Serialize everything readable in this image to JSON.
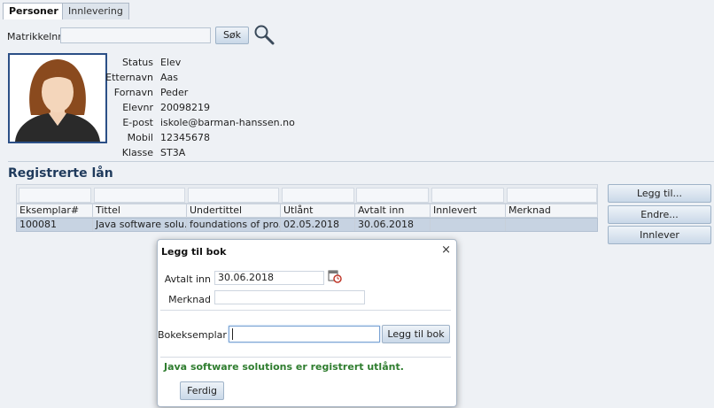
{
  "tabs": [
    {
      "label": "Personer",
      "active": true
    },
    {
      "label": "Innlevering",
      "active": false
    }
  ],
  "search": {
    "label": "Matrikkelnr",
    "value": "",
    "button": "Søk",
    "icon": "magnifier-icon"
  },
  "person": {
    "fields": [
      {
        "label": "Status",
        "value": "Elev"
      },
      {
        "label": "Etternavn",
        "value": "Aas"
      },
      {
        "label": "Fornavn",
        "value": "Peder"
      },
      {
        "label": "Elevnr",
        "value": "20098219"
      },
      {
        "label": "E-post",
        "value": "iskole@barman-hanssen.no"
      },
      {
        "label": "Mobil",
        "value": "12345678"
      },
      {
        "label": "Klasse",
        "value": "ST3A"
      }
    ]
  },
  "loans": {
    "title": "Registrerte lån",
    "columns": [
      "Eksemplar#",
      "Tittel",
      "Undertittel",
      "Utlånt",
      "Avtalt inn",
      "Innlevert",
      "Merknad"
    ],
    "rows": [
      [
        "100081",
        "Java software solu...",
        "foundations of pro...",
        "02.05.2018",
        "30.06.2018",
        "",
        ""
      ]
    ]
  },
  "actions": {
    "add": "Legg til...",
    "edit": "Endre...",
    "return": "Innlever"
  },
  "dialog": {
    "title": "Legg til bok",
    "close": "×",
    "due_label": "Avtalt inn",
    "due_value": "30.06.2018",
    "note_label": "Merknad",
    "note_value": "",
    "copy_label": "Bokeksemplar",
    "copy_value": "",
    "add_button": "Legg til bok",
    "message": "Java software solutions er registrert utlånt.",
    "done_button": "Ferdig"
  },
  "colors": {
    "accent": "#1f3a5c",
    "success": "#2f7d2f",
    "selected_row": "#c7d3e2"
  }
}
